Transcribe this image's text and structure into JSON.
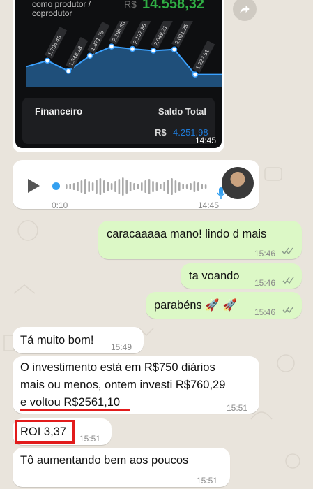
{
  "forwarded_image": {
    "metric_subtitle": "como produtor / coprodutor",
    "metric_currency": "R$",
    "metric_value": "14.558,32",
    "chart_labels": [
      "1.704,46",
      "1.348,18",
      "1.871,75",
      "2.188,63",
      "2.107,35",
      "2.049,21",
      "2.091,25",
      "1.227,51"
    ],
    "panel_title": "Financeiro",
    "panel_total_label": "Saldo Total",
    "panel_currency": "R$",
    "panel_value": "4.251,98",
    "time": "14:45"
  },
  "audio_message": {
    "duration": "0:10",
    "time": "14:45",
    "icons": [
      "play-icon",
      "mic-icon"
    ]
  },
  "messages": [
    {
      "side": "out",
      "text": "caracaaaaa mano! lindo d mais",
      "time": "15:46"
    },
    {
      "side": "out",
      "text": "ta voando",
      "time": "15:46"
    },
    {
      "side": "out",
      "text": "parabéns 🚀 🚀",
      "time": "15:46"
    },
    {
      "side": "in",
      "text": "Tá muito bom!",
      "time": "15:49"
    },
    {
      "side": "in",
      "lines": [
        "O investimento está em R$750 diários",
        "mais ou menos, ontem investi R$760,29",
        "e voltou R$2561,10"
      ],
      "time": "15:51"
    },
    {
      "side": "in",
      "text": "ROI 3,37",
      "time": "15:51"
    },
    {
      "side": "in",
      "text": "Tô aumentando bem aos poucos",
      "time": "15:51"
    }
  ],
  "colors": {
    "chat_bg": "#e9e4dc",
    "outgoing_bubble": "#dcf8c6",
    "incoming_bubble": "#ffffff",
    "highlight_red": "#e21b1b",
    "chart_fill": "#1f4f7a",
    "metric_green": "#2fae44"
  }
}
